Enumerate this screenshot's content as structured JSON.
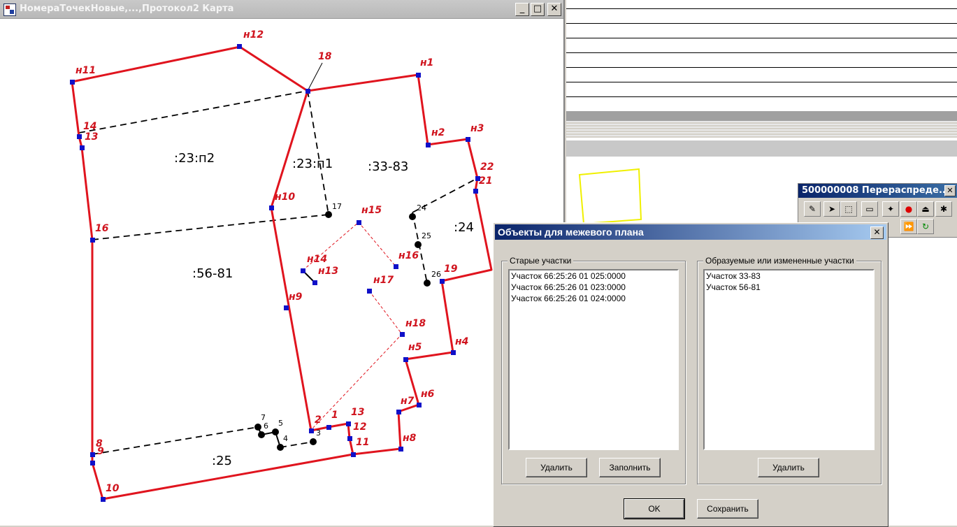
{
  "map_window": {
    "title": "НомераТочекНовые,...,Протокол2 Карта",
    "minimize": "_",
    "maximize": "□",
    "close": "✕"
  },
  "map": {
    "parcel_labels": [
      ":23:п2",
      ":23:п1",
      ":33-83",
      ":24",
      ":56-81",
      ":25"
    ],
    "red_point_labels": [
      "н12",
      "18",
      "н1",
      "н11",
      "14",
      "13",
      "н2",
      "н3",
      "22",
      "21",
      "н10",
      "н15",
      "16",
      "н14",
      "н13",
      "н16",
      "19",
      "н17",
      "н9",
      "н18",
      "н5",
      "н4",
      "н6",
      "н7",
      "н8",
      "2",
      "1",
      "13",
      "12",
      "11",
      "8",
      "9",
      "10"
    ],
    "black_point_labels": [
      "17",
      "24",
      "25",
      "26",
      "7",
      "6",
      "5",
      "4",
      "3"
    ]
  },
  "toolbar": {
    "title": "500000008 Перераспреде...",
    "close": "✕"
  },
  "dialog": {
    "title": "Объекты для межевого плана",
    "close": "✕",
    "old_group_label": "Старые участки",
    "old_items": [
      "Участок 66:25:26 01 025:0000",
      "Участок 66:25:26 01 023:0000",
      "Участок 66:25:26 01 024:0000"
    ],
    "new_group_label": "Образуемые или измененные участки",
    "new_items": [
      "Участок 33-83",
      "Участок 56-81"
    ],
    "delete_left": "Удалить",
    "fill": "Заполнить",
    "delete_right": "Удалить",
    "ok": "OK",
    "save": "Сохранить"
  },
  "colors": {
    "boundary_red": "#e0141e",
    "label_red": "#d0141e",
    "point_blue": "#1010c8",
    "highlight_yellow": "#f0f000"
  }
}
